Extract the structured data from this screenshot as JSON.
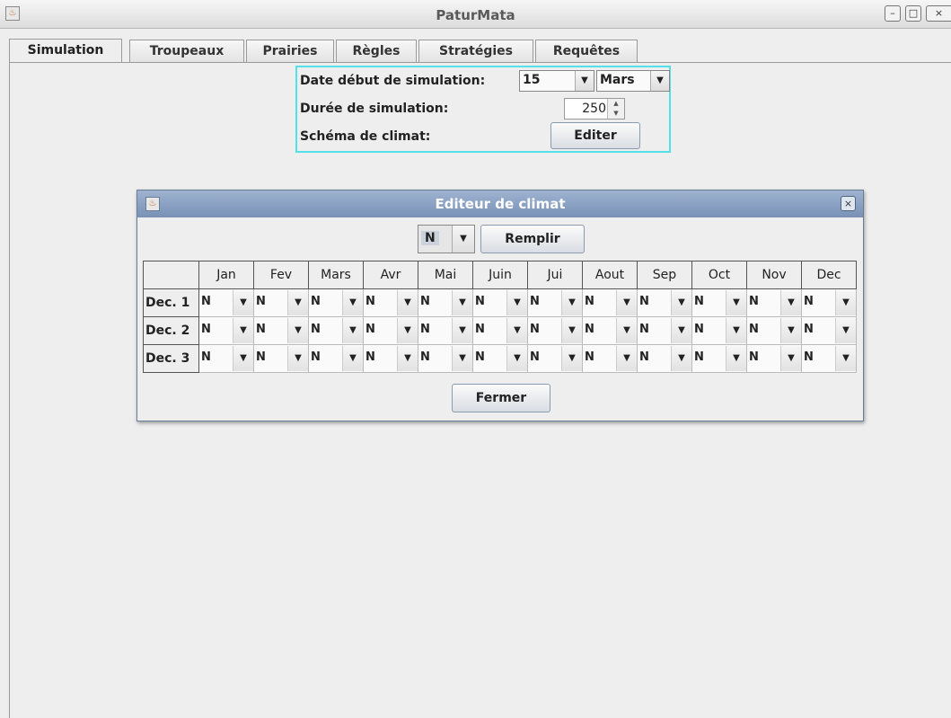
{
  "window": {
    "title": "PaturMata",
    "icon": "java-app-icon",
    "controls": [
      "_",
      "□",
      "×"
    ]
  },
  "tabs": [
    {
      "label": "Simulation",
      "active": true
    },
    {
      "label": "Troupeaux",
      "active": false
    },
    {
      "label": "Prairies",
      "active": false
    },
    {
      "label": "Règles",
      "active": false
    },
    {
      "label": "Stratégies",
      "active": false
    },
    {
      "label": "Requêtes",
      "active": false
    }
  ],
  "simulation": {
    "start_date_label": "Date début de simulation:",
    "start_day": "15",
    "start_month": "Mars",
    "duration_label": "Durée de simulation:",
    "duration_value": "250",
    "climate_label": "Schéma de climat:",
    "edit_button": "Editer",
    "panel_border_color": "#55e0e8"
  },
  "dialog": {
    "title": "Editeur de climat",
    "fill_value": "N",
    "fill_button": "Remplir",
    "close_button": "Fermer",
    "months": [
      "Jan",
      "Fev",
      "Mars",
      "Avr",
      "Mai",
      "Juin",
      "Jui",
      "Aout",
      "Sep",
      "Oct",
      "Nov",
      "Dec"
    ],
    "rows": [
      {
        "label": "Dec. 1",
        "values": [
          "N",
          "N",
          "N",
          "N",
          "N",
          "N",
          "N",
          "N",
          "N",
          "N",
          "N",
          "N"
        ]
      },
      {
        "label": "Dec. 2",
        "values": [
          "N",
          "N",
          "N",
          "N",
          "N",
          "N",
          "N",
          "N",
          "N",
          "N",
          "N",
          "N"
        ]
      },
      {
        "label": "Dec. 3",
        "values": [
          "N",
          "N",
          "N",
          "N",
          "N",
          "N",
          "N",
          "N",
          "N",
          "N",
          "N",
          "N"
        ]
      }
    ]
  }
}
